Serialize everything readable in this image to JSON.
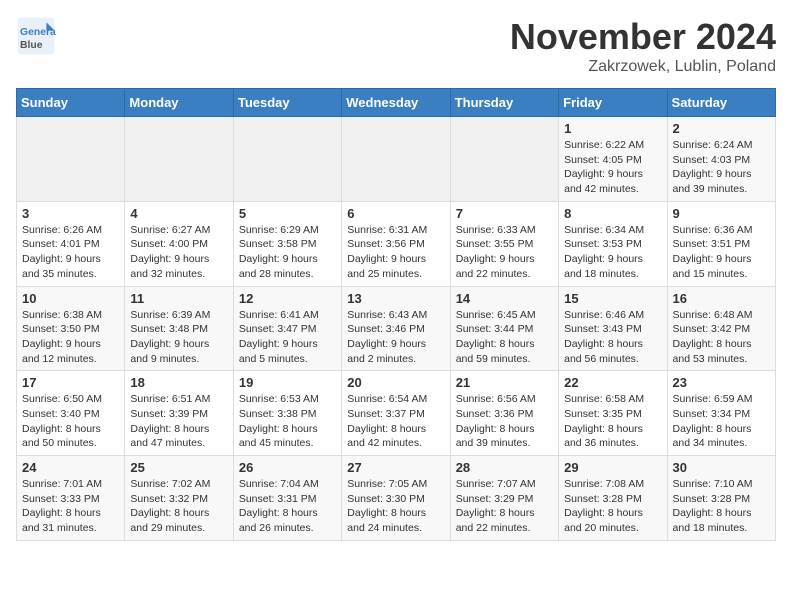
{
  "logo": {
    "line1": "General",
    "line2": "Blue"
  },
  "title": "November 2024",
  "location": "Zakrzowek, Lublin, Poland",
  "weekdays": [
    "Sunday",
    "Monday",
    "Tuesday",
    "Wednesday",
    "Thursday",
    "Friday",
    "Saturday"
  ],
  "weeks": [
    [
      {
        "day": "",
        "info": ""
      },
      {
        "day": "",
        "info": ""
      },
      {
        "day": "",
        "info": ""
      },
      {
        "day": "",
        "info": ""
      },
      {
        "day": "",
        "info": ""
      },
      {
        "day": "1",
        "info": "Sunrise: 6:22 AM\nSunset: 4:05 PM\nDaylight: 9 hours and 42 minutes."
      },
      {
        "day": "2",
        "info": "Sunrise: 6:24 AM\nSunset: 4:03 PM\nDaylight: 9 hours and 39 minutes."
      }
    ],
    [
      {
        "day": "3",
        "info": "Sunrise: 6:26 AM\nSunset: 4:01 PM\nDaylight: 9 hours and 35 minutes."
      },
      {
        "day": "4",
        "info": "Sunrise: 6:27 AM\nSunset: 4:00 PM\nDaylight: 9 hours and 32 minutes."
      },
      {
        "day": "5",
        "info": "Sunrise: 6:29 AM\nSunset: 3:58 PM\nDaylight: 9 hours and 28 minutes."
      },
      {
        "day": "6",
        "info": "Sunrise: 6:31 AM\nSunset: 3:56 PM\nDaylight: 9 hours and 25 minutes."
      },
      {
        "day": "7",
        "info": "Sunrise: 6:33 AM\nSunset: 3:55 PM\nDaylight: 9 hours and 22 minutes."
      },
      {
        "day": "8",
        "info": "Sunrise: 6:34 AM\nSunset: 3:53 PM\nDaylight: 9 hours and 18 minutes."
      },
      {
        "day": "9",
        "info": "Sunrise: 6:36 AM\nSunset: 3:51 PM\nDaylight: 9 hours and 15 minutes."
      }
    ],
    [
      {
        "day": "10",
        "info": "Sunrise: 6:38 AM\nSunset: 3:50 PM\nDaylight: 9 hours and 12 minutes."
      },
      {
        "day": "11",
        "info": "Sunrise: 6:39 AM\nSunset: 3:48 PM\nDaylight: 9 hours and 9 minutes."
      },
      {
        "day": "12",
        "info": "Sunrise: 6:41 AM\nSunset: 3:47 PM\nDaylight: 9 hours and 5 minutes."
      },
      {
        "day": "13",
        "info": "Sunrise: 6:43 AM\nSunset: 3:46 PM\nDaylight: 9 hours and 2 minutes."
      },
      {
        "day": "14",
        "info": "Sunrise: 6:45 AM\nSunset: 3:44 PM\nDaylight: 8 hours and 59 minutes."
      },
      {
        "day": "15",
        "info": "Sunrise: 6:46 AM\nSunset: 3:43 PM\nDaylight: 8 hours and 56 minutes."
      },
      {
        "day": "16",
        "info": "Sunrise: 6:48 AM\nSunset: 3:42 PM\nDaylight: 8 hours and 53 minutes."
      }
    ],
    [
      {
        "day": "17",
        "info": "Sunrise: 6:50 AM\nSunset: 3:40 PM\nDaylight: 8 hours and 50 minutes."
      },
      {
        "day": "18",
        "info": "Sunrise: 6:51 AM\nSunset: 3:39 PM\nDaylight: 8 hours and 47 minutes."
      },
      {
        "day": "19",
        "info": "Sunrise: 6:53 AM\nSunset: 3:38 PM\nDaylight: 8 hours and 45 minutes."
      },
      {
        "day": "20",
        "info": "Sunrise: 6:54 AM\nSunset: 3:37 PM\nDaylight: 8 hours and 42 minutes."
      },
      {
        "day": "21",
        "info": "Sunrise: 6:56 AM\nSunset: 3:36 PM\nDaylight: 8 hours and 39 minutes."
      },
      {
        "day": "22",
        "info": "Sunrise: 6:58 AM\nSunset: 3:35 PM\nDaylight: 8 hours and 36 minutes."
      },
      {
        "day": "23",
        "info": "Sunrise: 6:59 AM\nSunset: 3:34 PM\nDaylight: 8 hours and 34 minutes."
      }
    ],
    [
      {
        "day": "24",
        "info": "Sunrise: 7:01 AM\nSunset: 3:33 PM\nDaylight: 8 hours and 31 minutes."
      },
      {
        "day": "25",
        "info": "Sunrise: 7:02 AM\nSunset: 3:32 PM\nDaylight: 8 hours and 29 minutes."
      },
      {
        "day": "26",
        "info": "Sunrise: 7:04 AM\nSunset: 3:31 PM\nDaylight: 8 hours and 26 minutes."
      },
      {
        "day": "27",
        "info": "Sunrise: 7:05 AM\nSunset: 3:30 PM\nDaylight: 8 hours and 24 minutes."
      },
      {
        "day": "28",
        "info": "Sunrise: 7:07 AM\nSunset: 3:29 PM\nDaylight: 8 hours and 22 minutes."
      },
      {
        "day": "29",
        "info": "Sunrise: 7:08 AM\nSunset: 3:28 PM\nDaylight: 8 hours and 20 minutes."
      },
      {
        "day": "30",
        "info": "Sunrise: 7:10 AM\nSunset: 3:28 PM\nDaylight: 8 hours and 18 minutes."
      }
    ]
  ]
}
